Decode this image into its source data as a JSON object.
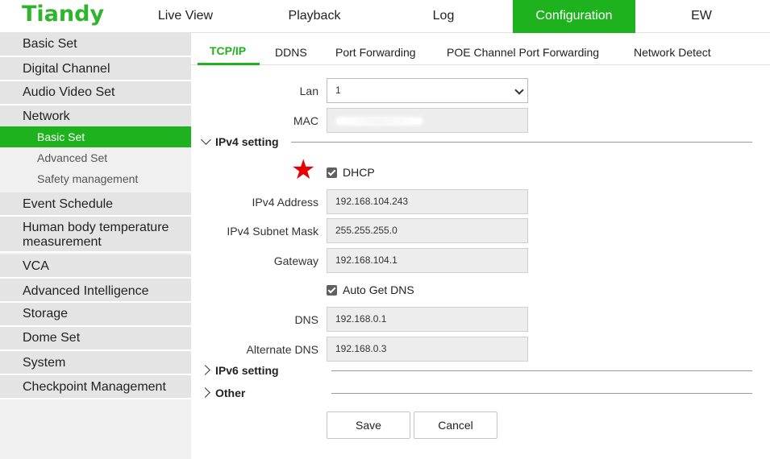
{
  "brand": {
    "logo": "Tiandy",
    "accent": "#1eb21e"
  },
  "nav": {
    "live_view": "Live View",
    "playback": "Playback",
    "log": "Log",
    "configuration": "Configuration",
    "ew": "EW"
  },
  "sidebar": {
    "items": [
      "Basic Set",
      "Digital Channel",
      "Audio Video Set",
      "Network",
      "Basic Set",
      "Advanced Set",
      "Safety management",
      "Event Schedule",
      "Human body temperature",
      "measurement",
      "VCA",
      "Advanced Intelligence",
      "Storage",
      "Dome Set",
      "System",
      "Checkpoint Management"
    ]
  },
  "tabs": [
    "TCP/IP",
    "DDNS",
    "Port Forwarding",
    "POE Channel Port Forwarding",
    "Network Detect"
  ],
  "form": {
    "lan_label": "Lan",
    "lan_value": "1",
    "mac_label": "MAC",
    "ipv4_section": "IPv4 setting",
    "dhcp_label": "DHCP",
    "ipv4_address_label": "IPv4 Address",
    "ipv4_address_value": "192.168.104.243",
    "subnet_label": "IPv4 Subnet Mask",
    "subnet_value": "255.255.255.0",
    "gateway_label": "Gateway",
    "gateway_value": "192.168.104.1",
    "auto_dns_label": "Auto Get DNS",
    "dns_label": "DNS",
    "dns_value": "192.168.0.1",
    "alt_dns_label": "Alternate DNS",
    "alt_dns_value": "192.168.0.3",
    "ipv6_section": "IPv6 setting",
    "other_section": "Other"
  },
  "buttons": {
    "save": "Save",
    "cancel": "Cancel"
  }
}
